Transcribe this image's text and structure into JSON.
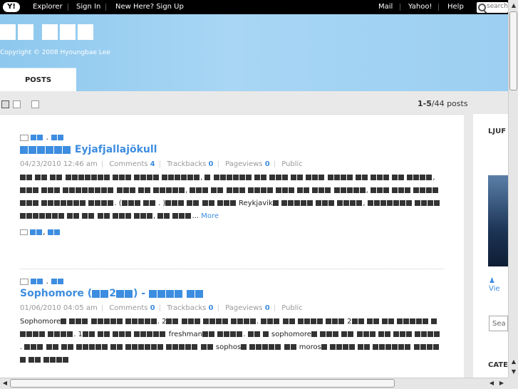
{
  "topbar": {
    "logo": "Y!",
    "left_links": [
      "Explorer",
      "Sign In",
      "New Here? Sign Up"
    ],
    "right_links": [
      "Mail",
      "Yahoo!",
      "Help"
    ],
    "search_placeholder": "search"
  },
  "header": {
    "copyright": "Copyright © 2008 Hyoungbae Lee",
    "tab": "POSTS"
  },
  "viewbar": {
    "range": "1-5",
    "total": "/44 posts"
  },
  "posts": [
    {
      "title_latin": "Eyjafjallajökull",
      "date": "04/23/2010 12:46 am",
      "comments_label": "Comments",
      "comments": "4",
      "trackbacks_label": "Trackbacks",
      "trackbacks": "0",
      "pageviews_label": "Pageviews",
      "pageviews": "0",
      "visibility": "Public",
      "body_word": "Reykjavik",
      "more": "More"
    },
    {
      "title_prefix": "Sophomore (",
      "title_mid": "2",
      "title_suffix": ") -",
      "date": "01/06/2010 04:05 am",
      "comments_label": "Comments",
      "comments": "0",
      "trackbacks_label": "Trackbacks",
      "trackbacks": "0",
      "pageviews_label": "Pageviews",
      "pageviews": "0",
      "visibility": "Public",
      "words": [
        "Sophomore",
        "2",
        "2",
        "1",
        "freshman",
        "sophomore",
        "sophos",
        "moros"
      ]
    }
  ],
  "sidebar": {
    "heading1": "LJUF",
    "view": "Vie",
    "search_text": "Sea",
    "heading2": "CATE"
  }
}
